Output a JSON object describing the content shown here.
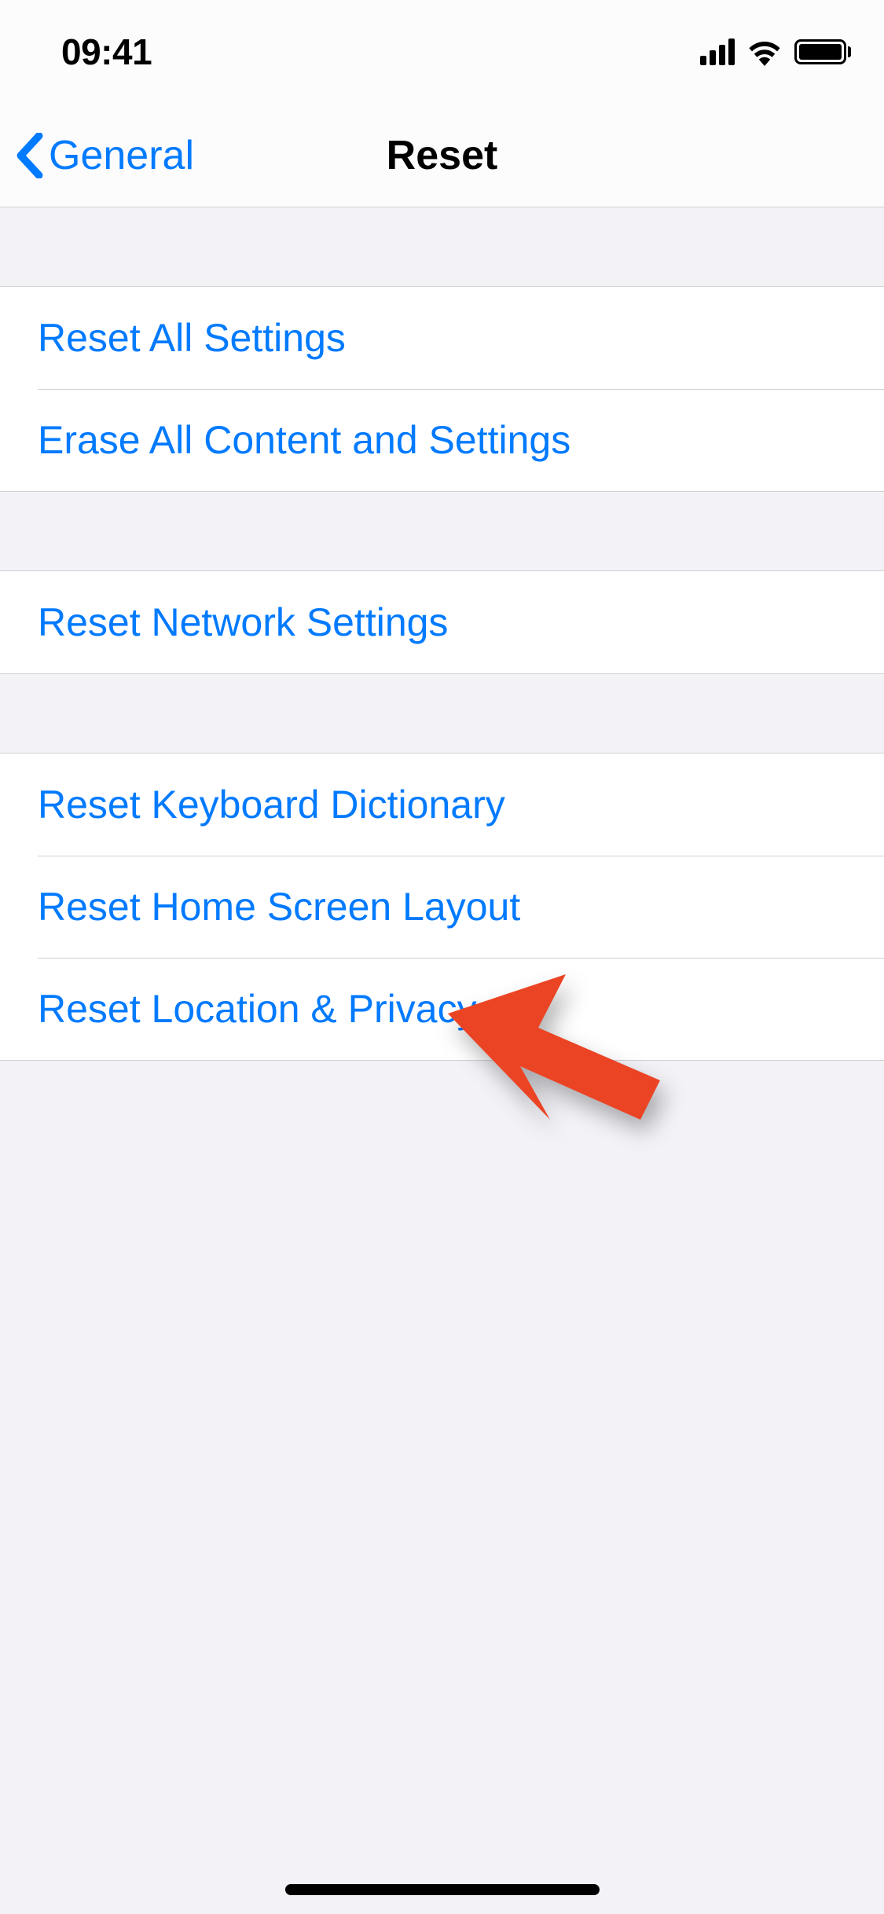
{
  "statusBar": {
    "time": "09:41"
  },
  "nav": {
    "backLabel": "General",
    "title": "Reset"
  },
  "sections": [
    {
      "rows": [
        {
          "label": "Reset All Settings"
        },
        {
          "label": "Erase All Content and Settings"
        }
      ]
    },
    {
      "rows": [
        {
          "label": "Reset Network Settings"
        }
      ]
    },
    {
      "rows": [
        {
          "label": "Reset Keyboard Dictionary"
        },
        {
          "label": "Reset Home Screen Layout"
        },
        {
          "label": "Reset Location & Privacy"
        }
      ]
    }
  ],
  "colors": {
    "link": "#007aff",
    "arrow": "#eb4425"
  }
}
